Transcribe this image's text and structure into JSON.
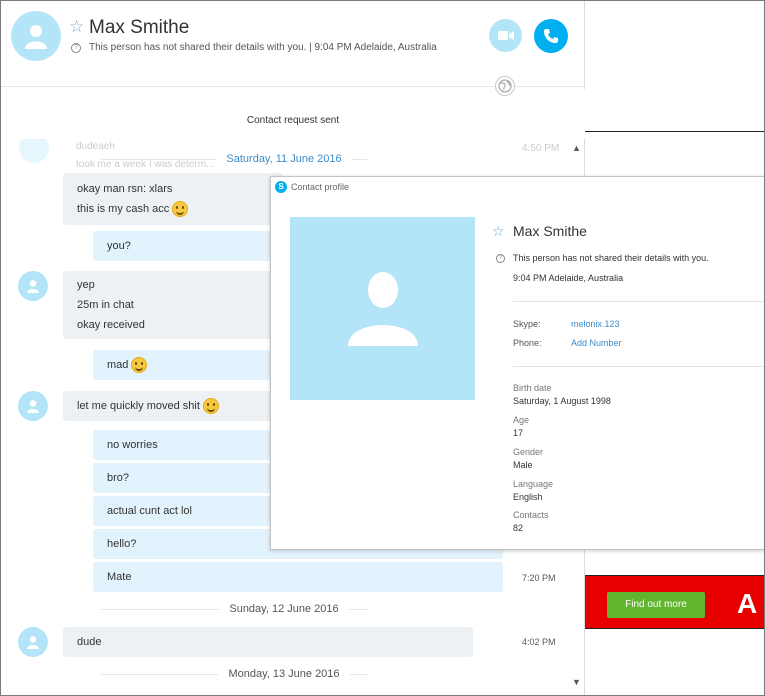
{
  "header": {
    "name": "Max Smithe",
    "details": "This person has not shared their details with you.  |  9:04 PM Adelaide, Australia"
  },
  "chat": {
    "request_sent": "Contact request sent",
    "ghost_name": "dudeaeh",
    "ghost_text": "took me a week I was determ...",
    "ghost_time": "4:50 PM",
    "dates": [
      "Saturday, 11 June 2016",
      "Sunday, 12 June 2016",
      "Monday, 13 June 2016"
    ],
    "messages": [
      {
        "side": "in",
        "lines": [
          "okay man rsn: xlars",
          "this is my cash acc"
        ]
      },
      {
        "side": "out",
        "lines": [
          "you?"
        ]
      },
      {
        "side": "in",
        "lines": [
          "yep",
          "25m in chat",
          "okay received"
        ]
      },
      {
        "side": "out",
        "lines": [
          "mad"
        ]
      },
      {
        "side": "in",
        "lines": [
          "let me quickly moved shit"
        ]
      },
      {
        "side": "out",
        "lines": [
          "no worries"
        ]
      },
      {
        "side": "out",
        "lines": [
          "bro?"
        ]
      },
      {
        "side": "out",
        "lines": [
          "actual cunt act lol"
        ]
      },
      {
        "side": "out",
        "lines": [
          "hello?"
        ]
      },
      {
        "side": "out",
        "lines": [
          "Mate"
        ]
      },
      {
        "side": "in",
        "lines": [
          "dude"
        ]
      }
    ],
    "times": {
      "mate": "7:20 PM",
      "dude": "4:02 PM"
    }
  },
  "ad": {
    "button": "Find out more",
    "logo": "A"
  },
  "profile": {
    "window_title": "Contact profile",
    "name": "Max Smithe",
    "status": "This person has not shared their details with you.",
    "time": "9:04 PM Adelaide, Australia",
    "skype_label": "Skype:",
    "skype_value": "melonix.123",
    "phone_label": "Phone:",
    "phone_value": "Add Number",
    "fields": [
      {
        "label": "Birth date",
        "value": "Saturday, 1 August 1998"
      },
      {
        "label": "Age",
        "value": "17"
      },
      {
        "label": "Gender",
        "value": "Male"
      },
      {
        "label": "Language",
        "value": "English"
      },
      {
        "label": "Contacts",
        "value": "82"
      }
    ]
  },
  "colors": {
    "skype_blue": "#00aff0",
    "avatar_bg": "#b4e4f8",
    "link": "#3c8bc9",
    "ad_red": "#e80000",
    "ad_green": "#62b52e"
  }
}
